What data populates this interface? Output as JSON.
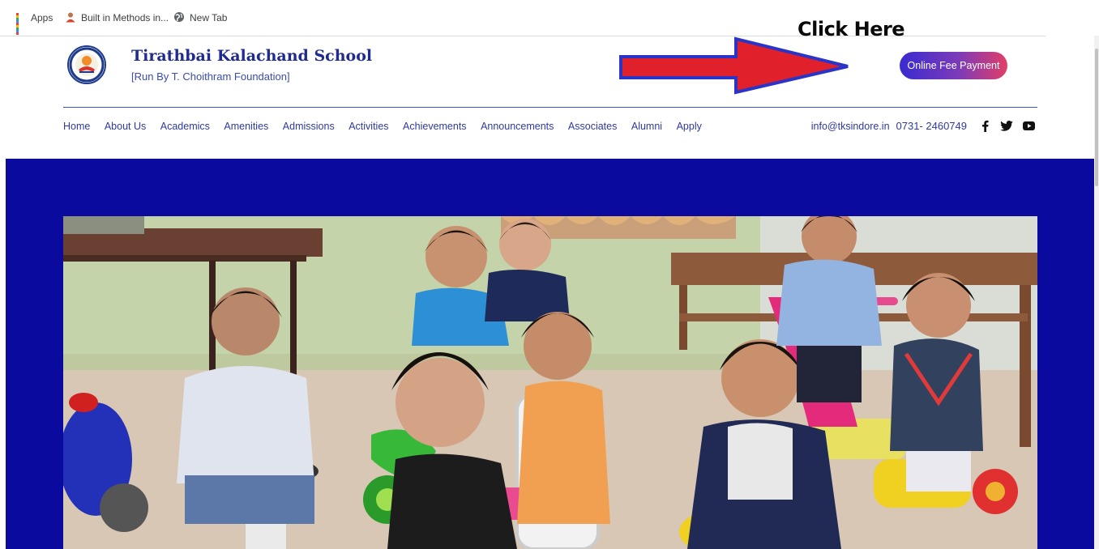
{
  "bookmarks": {
    "items": [
      {
        "label": "Apps",
        "icon": "apps-grid-icon"
      },
      {
        "label": "Built in Methods in...",
        "icon": "person-icon"
      },
      {
        "label": "New Tab",
        "icon": "globe-icon"
      }
    ]
  },
  "header": {
    "school_name": "Tirathbai Kalachand School",
    "school_sub": "[Run By T. Choithram Foundation]",
    "click_here": "Click Here",
    "fee_button": "Online Fee Payment"
  },
  "nav": {
    "items": [
      "Home",
      "About Us",
      "Academics",
      "Amenities",
      "Admissions",
      "Activities",
      "Achievements",
      "Announcements",
      "Associates",
      "Alumni",
      "Apply"
    ]
  },
  "contact": {
    "email": "info@tksindore.in",
    "phone": "0731- 2460749",
    "social_icons": [
      "facebook-icon",
      "twitter-icon",
      "youtube-icon"
    ]
  },
  "colors": {
    "brand_navy": "#1f2b8f",
    "hero_blue": "#0a0a9e",
    "arrow_red": "#e0202a",
    "arrow_outline": "#2a35c8"
  }
}
